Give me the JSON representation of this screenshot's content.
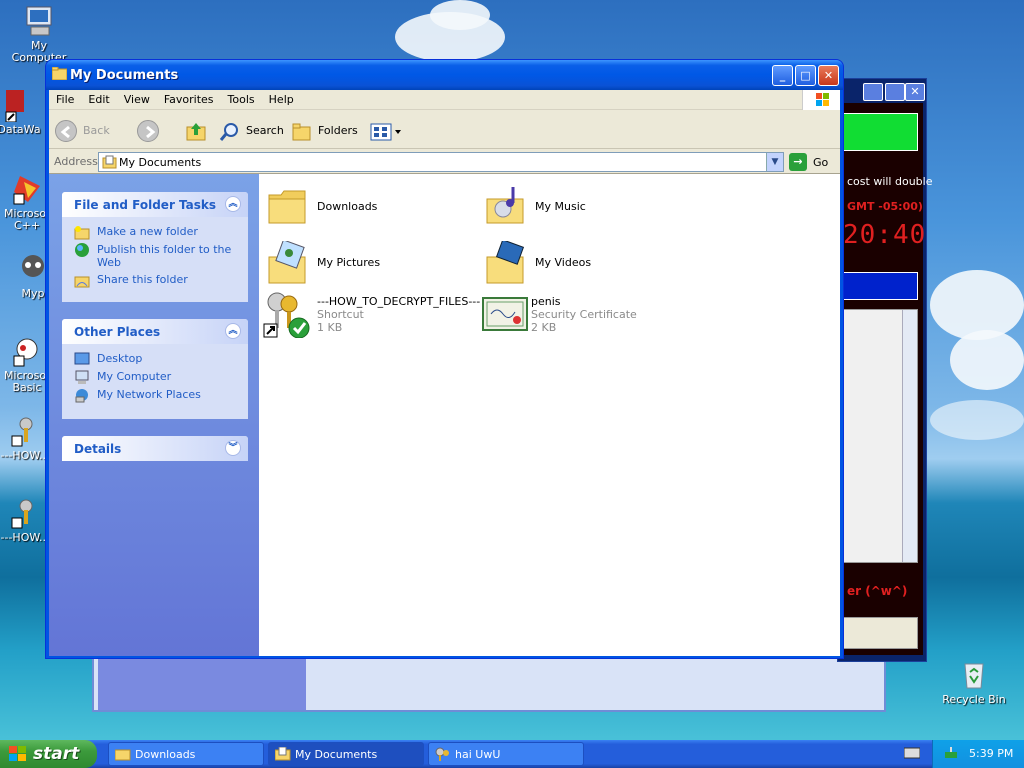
{
  "desktop": {
    "icons": [
      {
        "label": "My Computer"
      },
      {
        "label": "DataWa"
      },
      {
        "label": "Microsof C++"
      },
      {
        "label": "Myp"
      },
      {
        "label": "Microsof Basic"
      },
      {
        "label": "---HOW..."
      },
      {
        "label": "---HOW..."
      },
      {
        "label": "Recycle Bin"
      }
    ]
  },
  "background_window": {
    "text1": "cost will double",
    "text2": "GMT -05:00)",
    "clock": "20:40",
    "text3": "er (^w^)"
  },
  "window": {
    "title": "My Documents",
    "menu": [
      "File",
      "Edit",
      "View",
      "Favorites",
      "Tools",
      "Help"
    ],
    "toolbar": {
      "back": "Back",
      "search": "Search",
      "folders": "Folders"
    },
    "address": {
      "label": "Address",
      "value": "My Documents",
      "go": "Go"
    }
  },
  "taskpane": {
    "file_tasks": {
      "title": "File and Folder Tasks",
      "items": [
        "Make a new folder",
        "Publish this folder to the Web",
        "Share this folder"
      ]
    },
    "other_places": {
      "title": "Other Places",
      "items": [
        "Desktop",
        "My Computer",
        "My Network Places"
      ]
    },
    "details": {
      "title": "Details"
    }
  },
  "files": [
    {
      "name": "Downloads",
      "type": "",
      "size": ""
    },
    {
      "name": "My Music",
      "type": "",
      "size": ""
    },
    {
      "name": "My Pictures",
      "type": "",
      "size": ""
    },
    {
      "name": "My Videos",
      "type": "",
      "size": ""
    },
    {
      "name": "---HOW_TO_DECRYPT_FILES---",
      "type": "Shortcut",
      "size": "1 KB"
    },
    {
      "name": "penis",
      "type": "Security Certificate",
      "size": "2 KB"
    }
  ],
  "taskbar": {
    "start": "start",
    "tasks": [
      "Downloads",
      "My Documents",
      "hai UwU"
    ],
    "clock": "5:39 PM"
  },
  "colors": {
    "xp_blue": "#0054e3",
    "start_green": "#3c9a3c",
    "link_blue": "#215dc6"
  }
}
